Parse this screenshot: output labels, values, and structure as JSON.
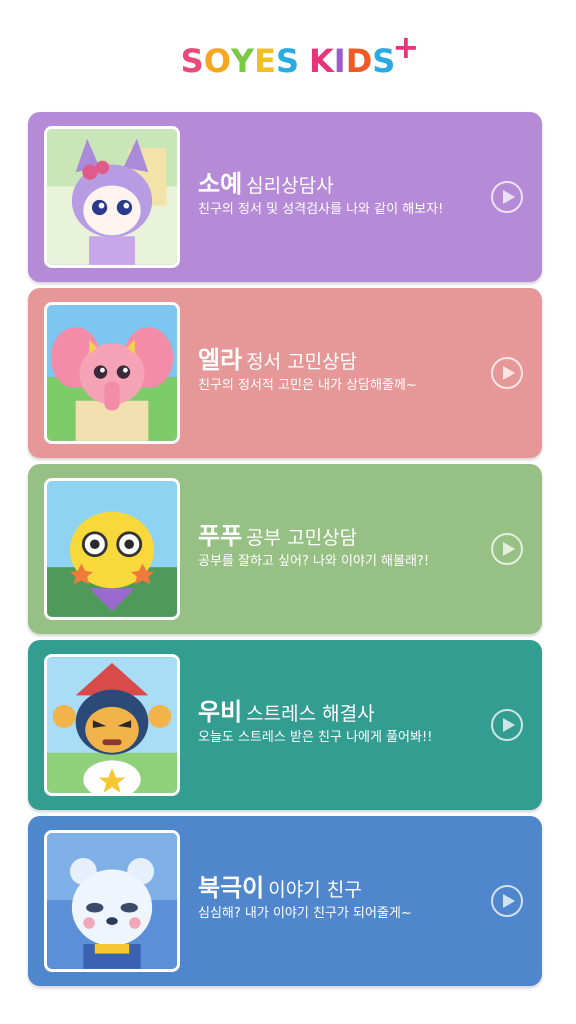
{
  "app": {
    "logo_chars": [
      "S",
      "O",
      "Y",
      "E",
      "S",
      " ",
      "K",
      "I",
      "D",
      "S"
    ],
    "logo_colors": [
      "#e84a7a",
      "#f5a623",
      "#7ac943",
      "#f0c020",
      "#29abe2",
      "#ffffff",
      "#e8337a",
      "#9b59d0",
      "#f15a24",
      "#29abe2"
    ],
    "logo_plus": "+"
  },
  "cards": [
    {
      "name": "소예",
      "role": "심리상담사",
      "desc": "친구의 정서 및 성격검사를 나와 같이 해보자!",
      "color": "#b58ad6",
      "icon": "cat-character-soye"
    },
    {
      "name": "엘라",
      "role": "정서 고민상담",
      "desc": "친구의 정서적 고민은 내가 상담해줄께~",
      "color": "#e69898",
      "icon": "elephant-character-ella"
    },
    {
      "name": "푸푸",
      "role": "공부 고민상담",
      "desc": "공부를 잘하고 싶어? 나와 이야기 해볼래?!",
      "color": "#97c084",
      "icon": "yellow-character-pupu"
    },
    {
      "name": "우비",
      "role": "스트레스 해결사",
      "desc": "오늘도 스트레스 받은 친구 나에게 풀어봐!!",
      "color": "#339d92",
      "icon": "character-ubi"
    },
    {
      "name": "북극이",
      "role": "이야기 친구",
      "desc": "심심해? 내가 이야기 친구가 되어줄게~",
      "color": "#4f86cc",
      "icon": "polar-bear-character-bukgeuki"
    }
  ]
}
